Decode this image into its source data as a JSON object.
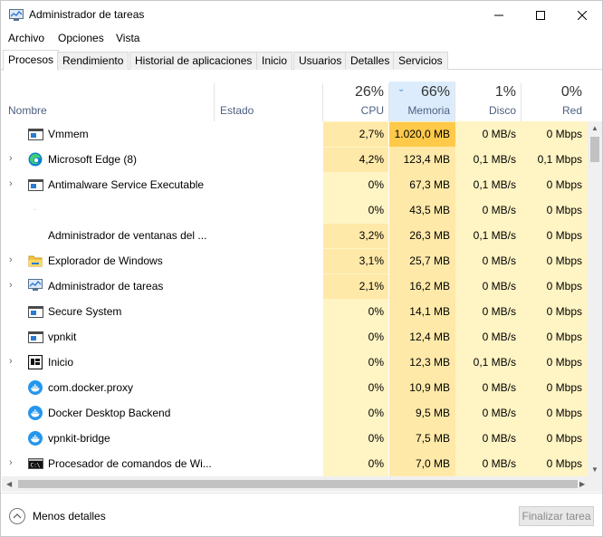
{
  "window": {
    "title": "Administrador de tareas"
  },
  "menu": [
    "Archivo",
    "Opciones",
    "Vista"
  ],
  "tabs": [
    "Procesos",
    "Rendimiento",
    "Historial de aplicaciones",
    "Inicio",
    "Usuarios",
    "Detalles",
    "Servicios"
  ],
  "active_tab": "Procesos",
  "columns": {
    "name": "Nombre",
    "status": "Estado",
    "cpu": {
      "pct": "26%",
      "label": "CPU"
    },
    "memory": {
      "pct": "66%",
      "label": "Memoria",
      "sorted": true
    },
    "disk": {
      "pct": "1%",
      "label": "Disco"
    },
    "network": {
      "pct": "0%",
      "label": "Red"
    }
  },
  "processes": [
    {
      "name": "Vmmem",
      "expandable": false,
      "icon": "window-app-icon",
      "cpu": "2,7%",
      "memory": "1.020,0 MB",
      "disk": "0 MB/s",
      "network": "0 Mbps"
    },
    {
      "name": "Microsoft Edge (8)",
      "expandable": true,
      "icon": "edge-icon",
      "cpu": "4,2%",
      "memory": "123,4 MB",
      "disk": "0,1 MB/s",
      "network": "0,1 Mbps"
    },
    {
      "name": "Antimalware Service Executable",
      "expandable": true,
      "icon": "window-app-icon",
      "cpu": "0%",
      "memory": "67,3 MB",
      "disk": "0,1 MB/s",
      "network": "0 Mbps"
    },
    {
      "name": "",
      "expandable": false,
      "icon": "blank-icon",
      "cpu": "0%",
      "memory": "43,5 MB",
      "disk": "0 MB/s",
      "network": "0 Mbps"
    },
    {
      "name": "Administrador de ventanas del ...",
      "expandable": false,
      "icon": "none",
      "cpu": "3,2%",
      "memory": "26,3 MB",
      "disk": "0,1 MB/s",
      "network": "0 Mbps"
    },
    {
      "name": "Explorador de Windows",
      "expandable": true,
      "icon": "folder-icon",
      "cpu": "3,1%",
      "memory": "25,7 MB",
      "disk": "0 MB/s",
      "network": "0 Mbps"
    },
    {
      "name": "Administrador de tareas",
      "expandable": true,
      "icon": "task-manager-icon",
      "cpu": "2,1%",
      "memory": "16,2 MB",
      "disk": "0 MB/s",
      "network": "0 Mbps"
    },
    {
      "name": "Secure System",
      "expandable": false,
      "icon": "window-app-icon",
      "cpu": "0%",
      "memory": "14,1 MB",
      "disk": "0 MB/s",
      "network": "0 Mbps"
    },
    {
      "name": "vpnkit",
      "expandable": false,
      "icon": "window-app-icon",
      "cpu": "0%",
      "memory": "12,4 MB",
      "disk": "0 MB/s",
      "network": "0 Mbps"
    },
    {
      "name": "Inicio",
      "expandable": true,
      "icon": "start-icon",
      "cpu": "0%",
      "memory": "12,3 MB",
      "disk": "0,1 MB/s",
      "network": "0 Mbps"
    },
    {
      "name": "com.docker.proxy",
      "expandable": false,
      "icon": "docker-icon",
      "cpu": "0%",
      "memory": "10,9 MB",
      "disk": "0 MB/s",
      "network": "0 Mbps"
    },
    {
      "name": "Docker Desktop Backend",
      "expandable": false,
      "icon": "docker-icon",
      "cpu": "0%",
      "memory": "9,5 MB",
      "disk": "0 MB/s",
      "network": "0 Mbps"
    },
    {
      "name": "vpnkit-bridge",
      "expandable": false,
      "icon": "docker-icon",
      "cpu": "0%",
      "memory": "7,5 MB",
      "disk": "0 MB/s",
      "network": "0 Mbps"
    },
    {
      "name": "Procesador de comandos de Wi...",
      "expandable": true,
      "icon": "cmd-icon",
      "cpu": "0%",
      "memory": "7,0 MB",
      "disk": "0 MB/s",
      "network": "0 Mbps"
    }
  ],
  "footer": {
    "less_details": "Menos detalles",
    "end_task": "Finalizar tarea"
  },
  "colors": {
    "cpu_bg": "#fff4c4",
    "cpu_hot": "#ffe9a8",
    "mem_bg": "#ffe9a8",
    "mem_hot": "#ffc94a",
    "disk_bg": "#fff4c4",
    "net_bg": "#fff4c4",
    "sorted_header": "#dcecfc"
  }
}
